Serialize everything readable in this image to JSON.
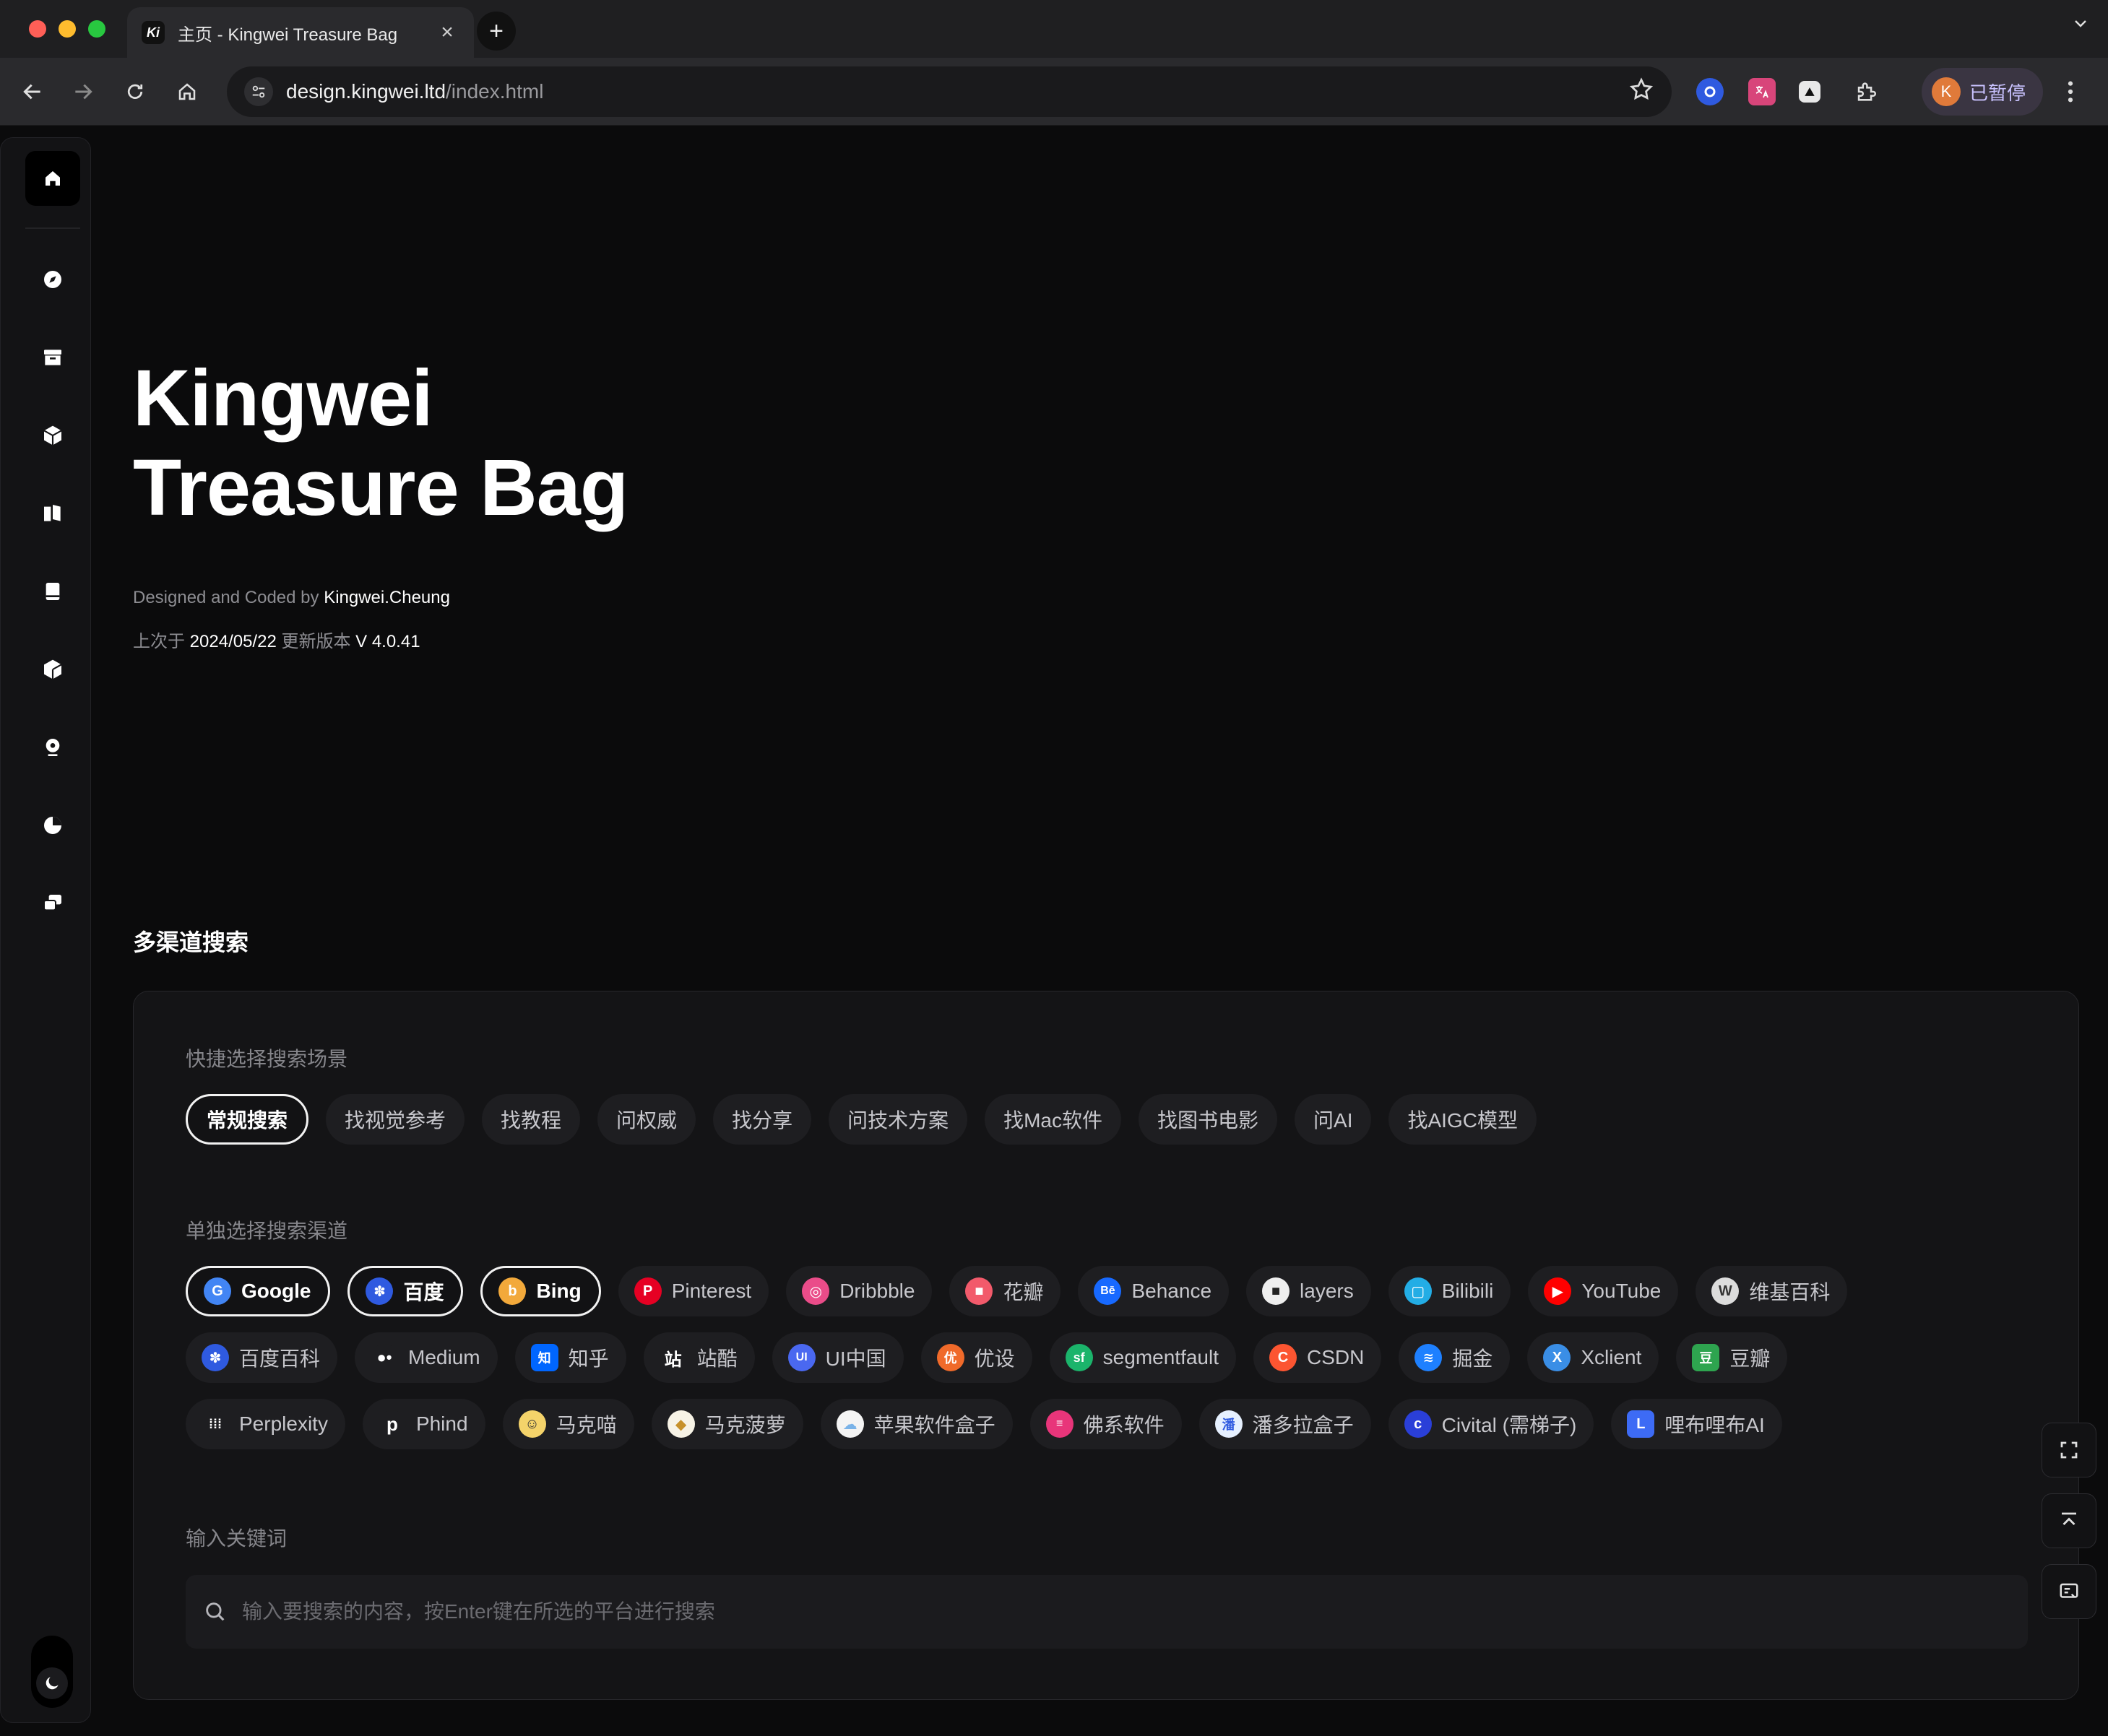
{
  "browser": {
    "tab_favicon": "Ki",
    "tab_title": "主页 - Kingwei Treasure Bag",
    "url_host": "design.kingwei.ltd",
    "url_path": "/index.html",
    "profile_initial": "K",
    "profile_label": "已暂停"
  },
  "hero": {
    "title_line1": "Kingwei",
    "title_line2": "Treasure Bag",
    "credit_prefix": "Designed and Coded by ",
    "credit_name": "Kingwei.Cheung",
    "updated_prefix": "上次于 ",
    "updated_date": "2024/05/22",
    "updated_mid": " 更新版本 ",
    "updated_version": "V 4.0.41"
  },
  "search": {
    "section_title": "多渠道搜索",
    "scene_label": "快捷选择搜索场景",
    "scenes": [
      "常规搜索",
      "找视觉参考",
      "找教程",
      "问权威",
      "找分享",
      "问技术方案",
      "找Mac软件",
      "找图书电影",
      "问AI",
      "找AIGC模型"
    ],
    "channel_label": "单独选择搜索渠道",
    "channels_row1": [
      "Google",
      "百度",
      "Bing",
      "Pinterest",
      "Dribbble",
      "花瓣",
      "Behance",
      "layers",
      "Bilibili",
      "YouTube",
      "维基百科"
    ],
    "channels_row2": [
      "百度百科",
      "Medium",
      "知乎",
      "站酷",
      "UI中国",
      "优设",
      "segmentfault",
      "CSDN",
      "掘金",
      "Xclient",
      "豆瓣"
    ],
    "channels_row3": [
      "Perplexity",
      "Phind",
      "马克喵",
      "马克菠萝",
      "苹果软件盒子",
      "佛系软件",
      "潘多拉盒子",
      "Civital (需梯子)",
      "哩布哩布AI"
    ],
    "keyword_label": "输入关键词",
    "placeholder": "输入要搜索的内容，按Enter键在所选的平台进行搜索"
  },
  "colors": {
    "background": "#0b0b0c",
    "card": "#141416",
    "pill": "#1e1e21",
    "accent_active_border": "#f2f2f2"
  }
}
